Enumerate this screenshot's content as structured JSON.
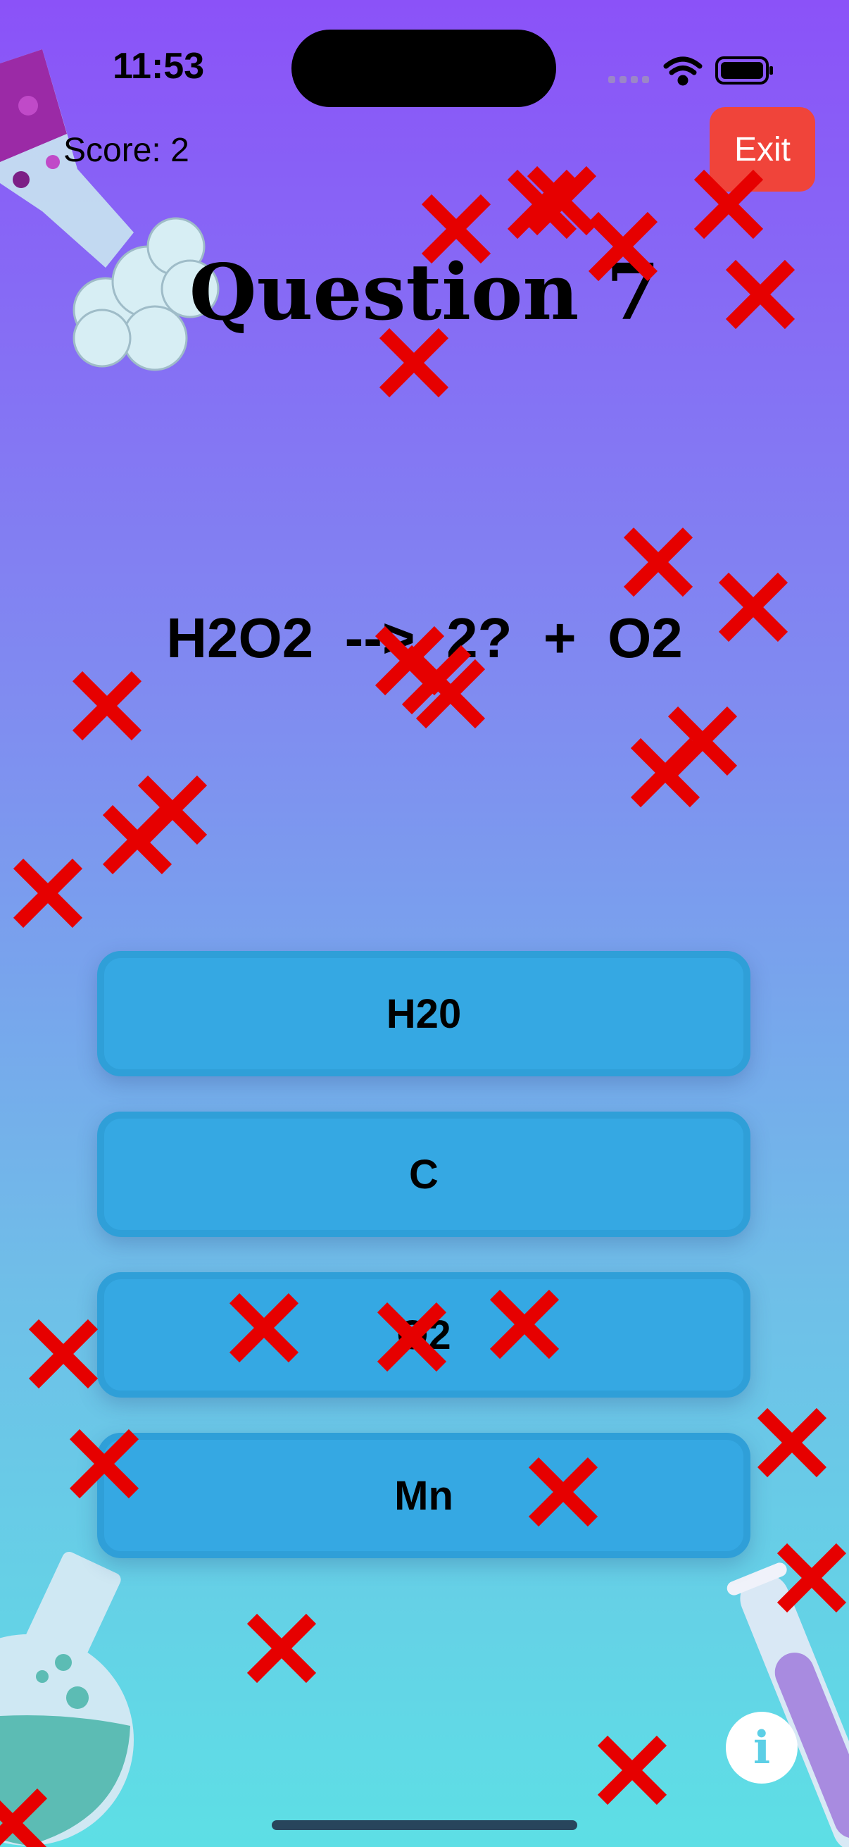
{
  "status_bar": {
    "time": "11:53"
  },
  "header": {
    "score_text": "Score: 2",
    "exit_label": "Exit"
  },
  "question": {
    "title": "Question 7",
    "equation": "H2O2  -->  2?  +  O2"
  },
  "answers": [
    {
      "label": "H20"
    },
    {
      "label": "C"
    },
    {
      "label": "O2"
    },
    {
      "label": "Mn"
    }
  ],
  "info_button": {
    "glyph": "i"
  },
  "colors": {
    "background_top": "#8b52f8",
    "background_bottom": "#5ddfe5",
    "answer_button": "#35a8e3",
    "exit_button": "#f0443a",
    "wrong_mark": "#e60000"
  },
  "icons": [
    "flask-pouring-icon",
    "flask-round-icon",
    "test-tube-icon",
    "x-mark-icon",
    "wifi-icon",
    "battery-icon",
    "signal-icon",
    "info-icon"
  ]
}
